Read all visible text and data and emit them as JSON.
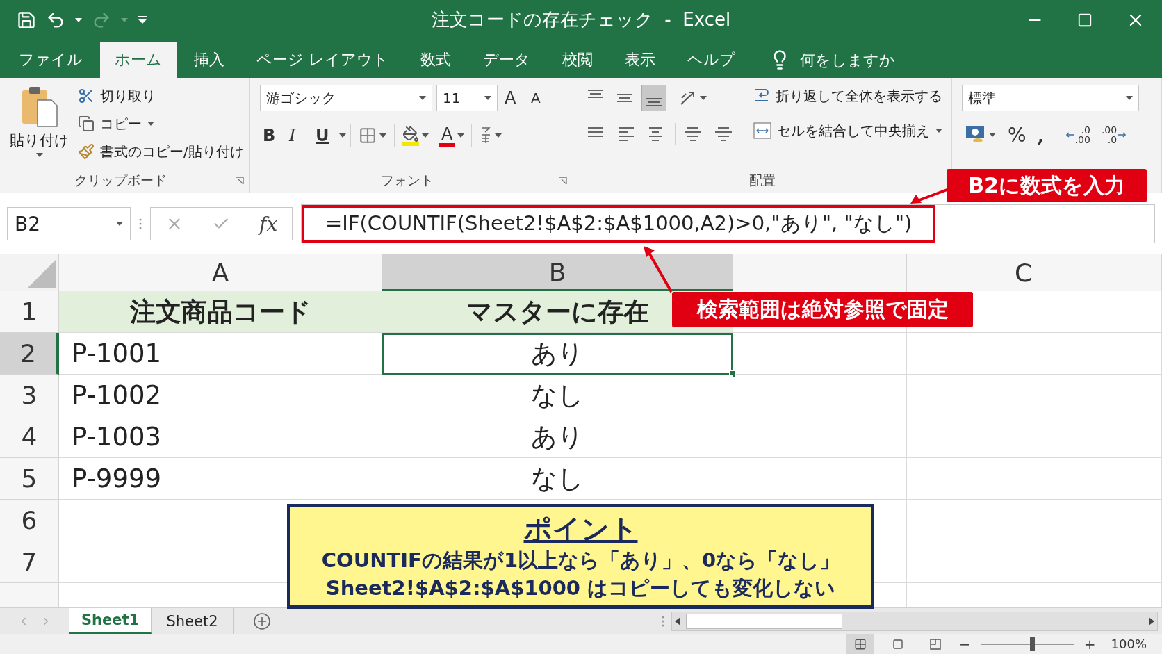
{
  "window": {
    "title": "注文コードの存在チェック  -  Excel"
  },
  "ribbon_tabs": [
    {
      "label": "ファイル",
      "selected": false
    },
    {
      "label": "ホーム",
      "selected": true
    },
    {
      "label": "挿入",
      "selected": false
    },
    {
      "label": "ページ レイアウト",
      "selected": false
    },
    {
      "label": "数式",
      "selected": false
    },
    {
      "label": "データ",
      "selected": false
    },
    {
      "label": "校閲",
      "selected": false
    },
    {
      "label": "表示",
      "selected": false
    },
    {
      "label": "ヘルプ",
      "selected": false
    }
  ],
  "tell_me": {
    "placeholder": "何をしますか"
  },
  "ribbon": {
    "clipboard": {
      "paste": "貼り付け",
      "cut": "切り取り",
      "copy": "コピー",
      "format_painter": "書式のコピー/貼り付け",
      "label": "クリップボード"
    },
    "font": {
      "name": "游ゴシック",
      "size": "11",
      "grow": "A",
      "shrink": "A",
      "bold": "B",
      "italic": "I",
      "underline": "U",
      "font_color": "A",
      "label": "フォント"
    },
    "alignment": {
      "vertical_align": [
        {
          "selected": false
        },
        {
          "selected": false
        },
        {
          "selected": true
        }
      ],
      "wrap_text": "折り返して全体を表示する",
      "merge": "セルを結合して中央揃え",
      "label": "配置"
    },
    "number": {
      "format": "標準",
      "percent": "%",
      "comma": ",",
      "increase_decimal": [
        ".0",
        ".00"
      ],
      "decrease_decimal": [
        ".00",
        ".0"
      ]
    }
  },
  "formula_bar": {
    "name_box": "B2",
    "fx": "fx",
    "formula": "=IF(COUNTIF(Sheet2!$A$2:$A$1000,A2)>0,\"あり\", \"なし\")"
  },
  "sheet": {
    "columns": [
      {
        "label": "A",
        "selected": false
      },
      {
        "label": "B",
        "selected": true
      },
      {
        "label": "C",
        "selected": false
      }
    ],
    "rows": [
      {
        "number": "1",
        "kind": "header",
        "selected": false,
        "cells": [
          {
            "text": "注文商品コード",
            "selected": false
          },
          {
            "text": "マスターに存在",
            "selected": false
          }
        ]
      },
      {
        "number": "2",
        "kind": "data",
        "selected": true,
        "cells": [
          {
            "text": "P-1001",
            "selected": false
          },
          {
            "text": "あり",
            "selected": true
          }
        ]
      },
      {
        "number": "3",
        "kind": "data",
        "selected": false,
        "cells": [
          {
            "text": "P-1002",
            "selected": false
          },
          {
            "text": "なし",
            "selected": false
          }
        ]
      },
      {
        "number": "4",
        "kind": "data",
        "selected": false,
        "cells": [
          {
            "text": "P-1003",
            "selected": false
          },
          {
            "text": "あり",
            "selected": false
          }
        ]
      },
      {
        "number": "5",
        "kind": "data",
        "selected": false,
        "cells": [
          {
            "text": "P-9999",
            "selected": false
          },
          {
            "text": "なし",
            "selected": false
          }
        ]
      },
      {
        "number": "6",
        "kind": "data",
        "selected": false
      },
      {
        "number": "7",
        "kind": "data",
        "selected": false
      }
    ]
  },
  "callouts": [
    {
      "text": "B2に数式を入力"
    },
    {
      "text": "検索範囲は絶対参照で固定"
    }
  ],
  "point": {
    "title": "ポイント",
    "lines": [
      "COUNTIFの結果が1以上なら「あり」、0なら「なし」",
      "Sheet2!$A$2:$A$1000 はコピーしても変化しない"
    ]
  },
  "sheet_tabs": [
    {
      "label": "Sheet1",
      "selected": true
    },
    {
      "label": "Sheet2",
      "selected": false
    }
  ],
  "status_bar": {
    "zoom_out": "−",
    "zoom_in": "+",
    "zoom": "100%",
    "zoom_slider": {
      "level": 0.55
    }
  }
}
